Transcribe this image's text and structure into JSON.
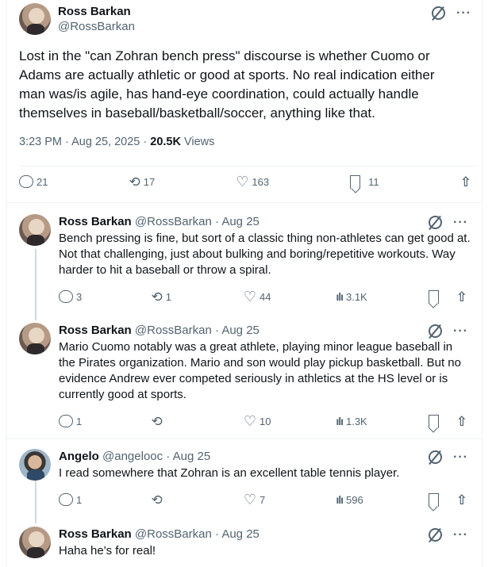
{
  "main_tweet": {
    "author_name": "Ross Barkan",
    "author_handle": "@RossBarkan",
    "text": "Lost in the \"can Zohran bench press\" discourse is whether Cuomo or Adams are actually athletic or good at sports. No real indication either man was/is agile, has hand-eye coordination, could actually handle themselves in baseball/basketball/soccer, anything like that.",
    "time": "3:23 PM · Aug 25, 2025 · ",
    "views_count": "20.5K",
    "views_label": " Views",
    "replies": "21",
    "reposts": "17",
    "likes": "163",
    "bookmarks": "11"
  },
  "replies": [
    {
      "author_name": "Ross Barkan",
      "author_handle": "@RossBarkan",
      "date": " · Aug 25",
      "text": "Bench pressing is fine, but sort of a classic thing non-athletes can get good at. Not that challenging, just about bulking and boring/repetitive workouts. Way harder to hit a baseball or throw a spiral.",
      "replies": "3",
      "reposts": "1",
      "likes": "44",
      "views": "3.1K"
    },
    {
      "author_name": "Ross Barkan",
      "author_handle": "@RossBarkan",
      "date": " · Aug 25",
      "text": "Mario Cuomo notably was a great athlete, playing minor league baseball in the Pirates organization. Mario and son would play pickup basketball. But no evidence Andrew ever competed seriously in athletics at the HS level or is currently good at sports.",
      "replies": "1",
      "reposts": "",
      "likes": "10",
      "views": "1.3K"
    },
    {
      "author_name": "Angelo",
      "author_handle": "@angelooc",
      "date": " · Aug 25",
      "text": "I read somewhere that Zohran is an excellent table tennis player.",
      "replies": "1",
      "reposts": "",
      "likes": "7",
      "views": "596"
    },
    {
      "author_name": "Ross Barkan",
      "author_handle": "@RossBarkan",
      "date": " · Aug 25",
      "text": "Haha he's for real!"
    }
  ],
  "icons": {
    "more": "···",
    "retweet": "⟲",
    "like": "♡",
    "views": "ılı",
    "share": "⇧"
  }
}
